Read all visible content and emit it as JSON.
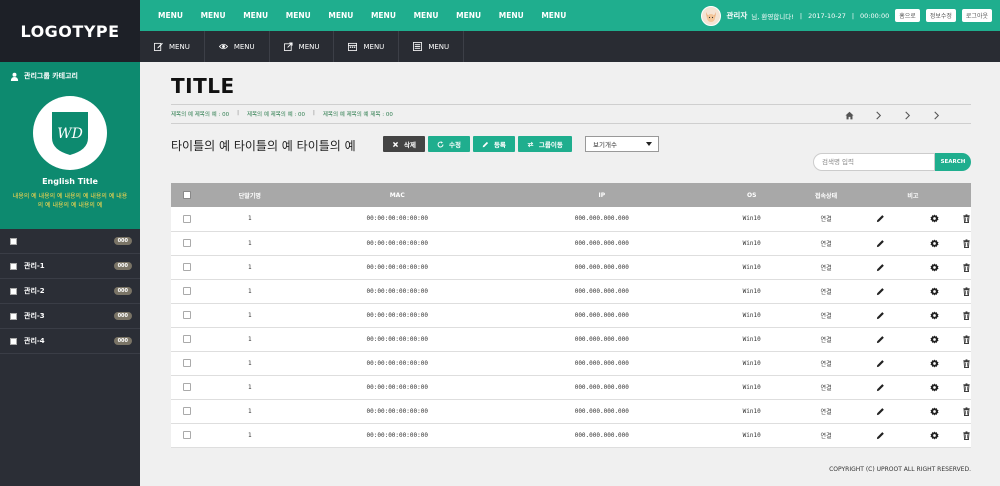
{
  "logo": "LOGOTYPE",
  "sidebar": {
    "category_title": "관리그룹 카테고리",
    "emblem_text": "WD",
    "english_title": "English Title",
    "description": "내용의 예 내용의 예 내용의 예 내용의 예 내용의 예 내용의 예 내용의 예",
    "items": [
      {
        "label": "",
        "badge": "000"
      },
      {
        "label": "관리-1",
        "badge": "000"
      },
      {
        "label": "관리-2",
        "badge": "000"
      },
      {
        "label": "관리-3",
        "badge": "000"
      },
      {
        "label": "관리-4",
        "badge": "000"
      }
    ]
  },
  "topbar": {
    "menus": [
      "MENU",
      "MENU",
      "MENU",
      "MENU",
      "MENU",
      "MENU",
      "MENU",
      "MENU",
      "MENU",
      "MENU"
    ],
    "user_name": "관리자",
    "greeting": "님, 환영합니다!",
    "date": "2017-10-27",
    "time": "00:00:00",
    "home_button": "홈으로",
    "edit_info_button": "정보수정",
    "logout_button": "로그아웃"
  },
  "subbar": {
    "items": [
      {
        "label": "MENU",
        "icon": "edit-icon"
      },
      {
        "label": "MENU",
        "icon": "eye-icon"
      },
      {
        "label": "MENU",
        "icon": "share-icon"
      },
      {
        "label": "MENU",
        "icon": "calendar-icon"
      },
      {
        "label": "MENU",
        "icon": "list-icon"
      }
    ]
  },
  "page": {
    "title": "TITLE",
    "breadcrumbs": [
      "제목의 예 제목의 예 : 00",
      "제목의 예 제목의 예 : 00",
      "제목의 예 제목의 예 제목 : 00"
    ],
    "section_title": "타이틀의 예 타이틀의 예 타이틀의 예",
    "actions": {
      "delete": "삭제",
      "edit": "수정",
      "register": "등록",
      "move_group": "그룹이동"
    },
    "view_count_label": "보기개수",
    "search": {
      "placeholder": "검색명 입력",
      "button": "SEARCH"
    },
    "footer": "COPYRIGHT (C) UPROOT ALL RIGHT RESERVED."
  },
  "table": {
    "headers": [
      "단말기명",
      "MAC",
      "IP",
      "OS",
      "접속상태",
      "비고"
    ],
    "rows": [
      {
        "name": "1",
        "mac": "00:00:00:00:00:00",
        "ip": "000.000.000.000",
        "os": "Win10",
        "status": "연결"
      },
      {
        "name": "1",
        "mac": "00:00:00:00:00:00",
        "ip": "000.000.000.000",
        "os": "Win10",
        "status": "연결"
      },
      {
        "name": "1",
        "mac": "00:00:00:00:00:00",
        "ip": "000.000.000.000",
        "os": "Win10",
        "status": "연결"
      },
      {
        "name": "1",
        "mac": "00:00:00:00:00:00",
        "ip": "000.000.000.000",
        "os": "Win10",
        "status": "연결"
      },
      {
        "name": "1",
        "mac": "00:00:00:00:00:00",
        "ip": "000.000.000.000",
        "os": "Win10",
        "status": "연결"
      },
      {
        "name": "1",
        "mac": "00:00:00:00:00:00",
        "ip": "000.000.000.000",
        "os": "Win10",
        "status": "연결"
      },
      {
        "name": "1",
        "mac": "00:00:00:00:00:00",
        "ip": "000.000.000.000",
        "os": "Win10",
        "status": "연결"
      },
      {
        "name": "1",
        "mac": "00:00:00:00:00:00",
        "ip": "000.000.000.000",
        "os": "Win10",
        "status": "연결"
      },
      {
        "name": "1",
        "mac": "00:00:00:00:00:00",
        "ip": "000.000.000.000",
        "os": "Win10",
        "status": "연결"
      },
      {
        "name": "1",
        "mac": "00:00:00:00:00:00",
        "ip": "000.000.000.000",
        "os": "Win10",
        "status": "연결"
      }
    ]
  },
  "colors": {
    "accent": "#1fae8e",
    "sidebar_panel": "#0d8a6f",
    "dark": "#292c33",
    "highlight": "#ffd84d"
  }
}
